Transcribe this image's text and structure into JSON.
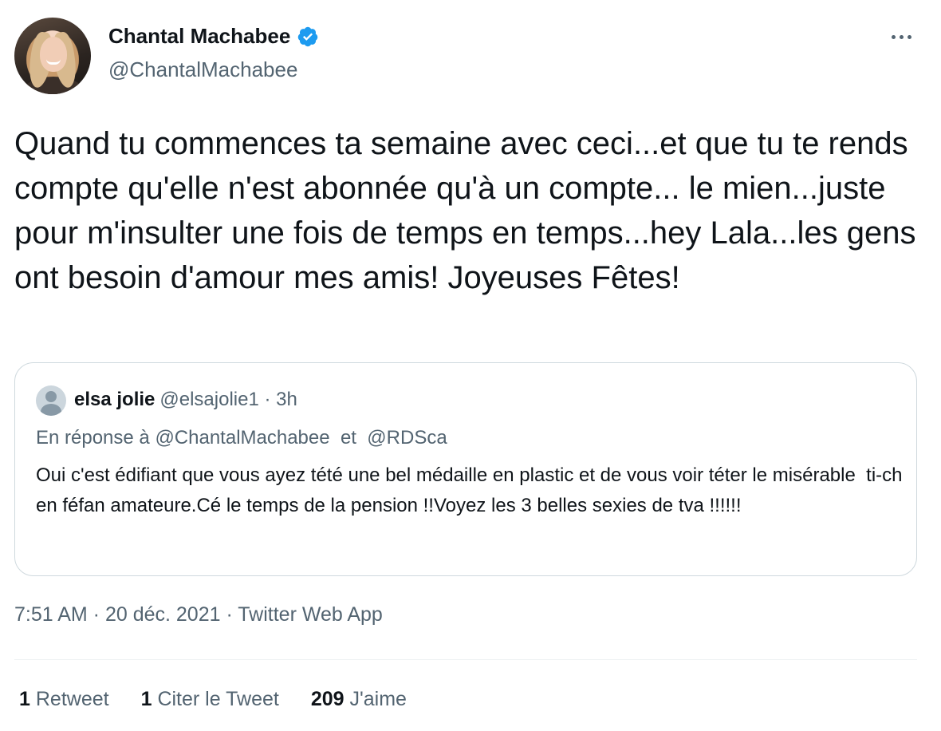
{
  "author": {
    "display_name": "Chantal Machabee",
    "handle": "@ChantalMachabee",
    "verified": true
  },
  "tweet": {
    "text": "Quand tu commences ta semaine avec ceci...et que tu te rends compte qu'elle n'est abonnée qu'à un compte... le mien...juste pour m'insulter une fois de temps en temps...hey Lala...les gens ont besoin d'amour mes amis! Joyeuses Fêtes!",
    "timestamp": "7:51 AM · 20 déc. 2021 · Twitter Web App"
  },
  "quote": {
    "display_name": "elsa jolie",
    "handle_time": "@elsajolie1 · 3h",
    "reply_to": "En réponse à @ChantalMachabee  et  @RDSca",
    "text": "Oui c'est édifiant que vous ayez tété une bel médaille en plastic et de vous voir téter le misérable  ti-ch en féfan amateure.Cé le temps de la pension !!Voyez les 3 belles sexies de tva !!!!!!"
  },
  "stats": {
    "retweets": {
      "count": "1",
      "label": "Retweet"
    },
    "quotes": {
      "count": "1",
      "label": "Citer le Tweet"
    },
    "likes": {
      "count": "209",
      "label": "J'aime"
    }
  },
  "colors": {
    "verified_blue": "#1d9bf0",
    "secondary_text": "#536471",
    "border": "#cfd9de"
  }
}
